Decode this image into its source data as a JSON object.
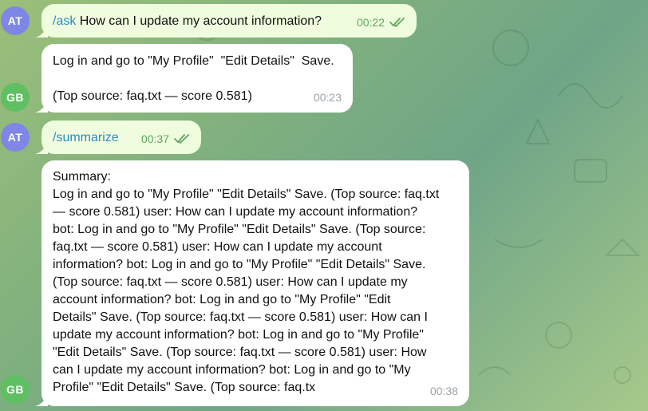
{
  "messages": [
    {
      "sender_initials": "AT",
      "command": "/ask",
      "text": " How can I update my account information?",
      "time": "00:22",
      "status_icon": "double-check-icon"
    },
    {
      "sender_initials": "GB",
      "text": "Log in and go to \"My Profile\"  \"Edit Details\"  Save.\n\n(Top source: faq.txt — score 0.581)",
      "time": "00:23"
    },
    {
      "sender_initials": "AT",
      "command": "/summarize",
      "time": "00:37",
      "status_icon": "double-check-icon"
    },
    {
      "sender_initials": "GB",
      "text": "Summary:\nLog in and go to \"My Profile\" \"Edit Details\" Save. (Top source: faq.txt\n— score 0.581) user: How can I update my account information?\nbot: Log in and go to \"My Profile\" \"Edit Details\" Save. (Top source:\nfaq.txt — score 0.581) user: How can I update my account\ninformation? bot: Log in and go to \"My Profile\" \"Edit Details\" Save.\n(Top source: faq.txt — score 0.581) user: How can I update my\naccount information? bot: Log in and go to \"My Profile\" \"Edit\nDetails\" Save. (Top source: faq.txt — score 0.581) user: How can I\nupdate my account information? bot: Log in and go to \"My Profile\"\n\"Edit Details\" Save. (Top source: faq.txt — score 0.581) user: How\ncan I update my account information? bot: Log in and go to \"My\nProfile\" \"Edit Details\" Save. (Top source: faq.tx",
      "time": "00:38"
    }
  ],
  "colors": {
    "outgoing_bubble": "#effdde",
    "incoming_bubble": "#ffffff",
    "command_link": "#2a8bc5",
    "avatar_at": "#7f86e6",
    "avatar_gb": "#5fbf63"
  }
}
